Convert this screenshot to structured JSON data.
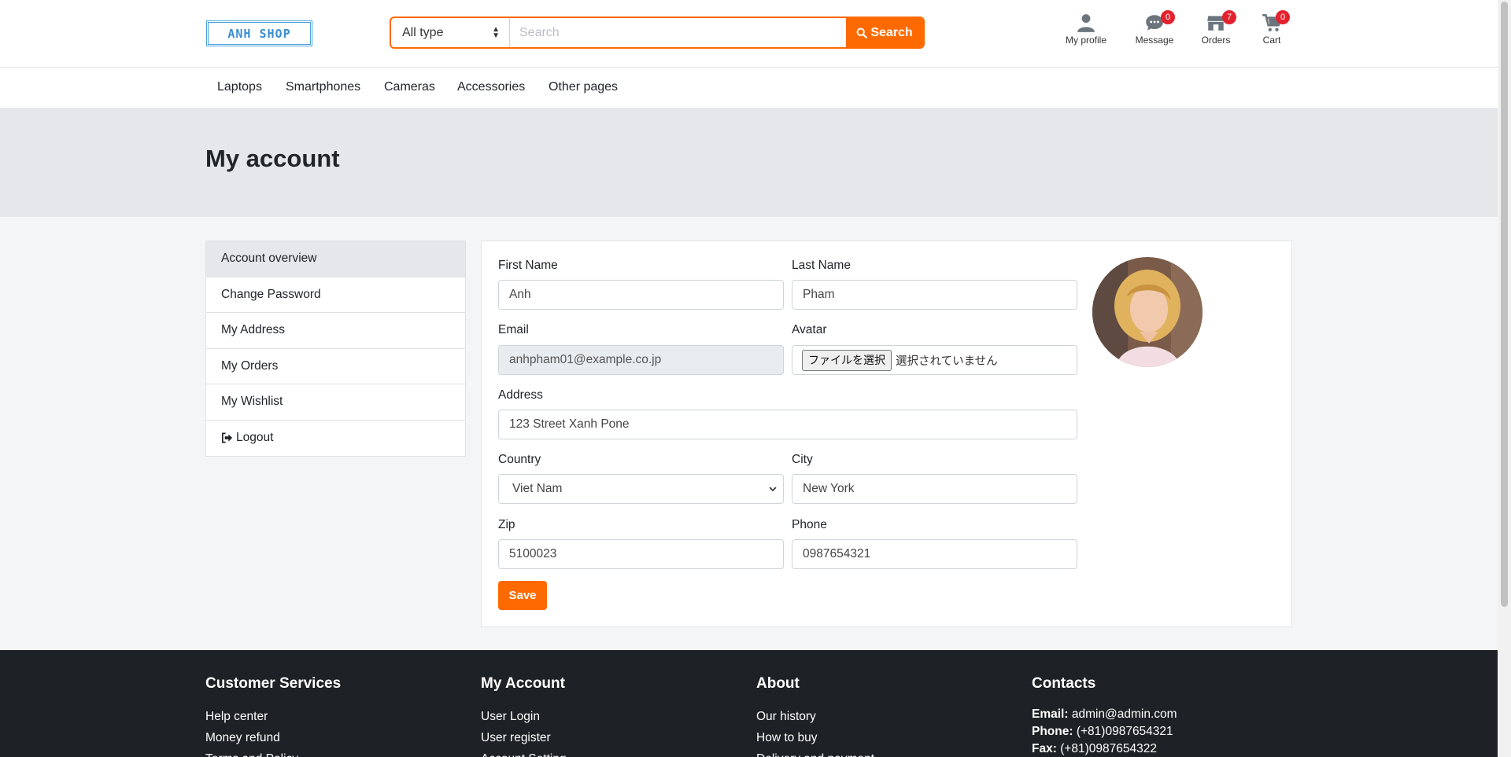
{
  "header": {
    "logo_text": "ANH SHOP",
    "search_type": "All type",
    "search_placeholder": "Search",
    "search_button": "Search",
    "icons": [
      {
        "label": "My profile",
        "icon": "user-icon",
        "badge": ""
      },
      {
        "label": "Message",
        "icon": "message-icon",
        "badge": "0"
      },
      {
        "label": "Orders",
        "icon": "orders-icon",
        "badge": "7"
      },
      {
        "label": "Cart",
        "icon": "cart-icon",
        "badge": "0"
      }
    ]
  },
  "nav": [
    "Laptops",
    "Smartphones",
    "Cameras",
    "Accessories",
    "Other pages"
  ],
  "page_title": "My account",
  "sidebar": {
    "items": [
      "Account overview",
      "Change Password",
      "My Address",
      "My Orders",
      "My Wishlist",
      "Logout"
    ]
  },
  "form": {
    "first_name_label": "First Name",
    "first_name": "Anh",
    "last_name_label": "Last Name",
    "last_name": "Pham",
    "email_label": "Email",
    "email": "anhpham01@example.co.jp",
    "avatar_label": "Avatar",
    "file_button": "ファイルを選択",
    "file_status": "選択されていません",
    "address_label": "Address",
    "address": "123 Street Xanh Pone",
    "country_label": "Country",
    "country": "Viet Nam",
    "city_label": "City",
    "city": "New York",
    "zip_label": "Zip",
    "zip": "5100023",
    "phone_label": "Phone",
    "phone": "0987654321",
    "save_button": "Save"
  },
  "footer": {
    "customer_services": {
      "title": "Customer Services",
      "links": [
        "Help center",
        "Money refund",
        "Terms and Policy"
      ]
    },
    "my_account": {
      "title": "My Account",
      "links": [
        "User Login",
        "User register",
        "Account Setting"
      ]
    },
    "about": {
      "title": "About",
      "links": [
        "Our history",
        "How to buy",
        "Delivery and payment"
      ]
    },
    "contacts": {
      "title": "Contacts",
      "email_label": "Email:",
      "email": "admin@admin.com",
      "phone_label": "Phone:",
      "phone": "(+81)0987654321",
      "fax_label": "Fax:",
      "fax": "(+81)0987654322"
    }
  },
  "colors": {
    "accent": "#ff6a00",
    "badge": "#e4222e",
    "footer_bg": "#1e2125"
  }
}
